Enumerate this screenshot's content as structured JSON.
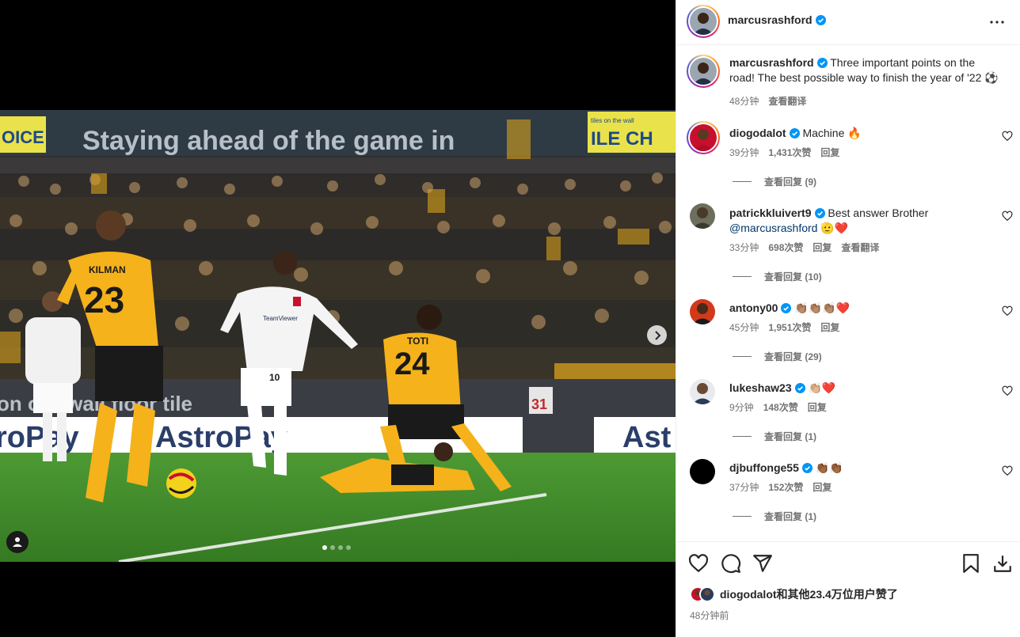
{
  "post": {
    "author": "marcusrashford",
    "caption": "Three important points on the road! The best possible way to finish the year of '22 ⚽",
    "caption_time": "48分钟",
    "translate_label": "查看翻译"
  },
  "photo": {
    "banner_text": "Staying ahead of the game in",
    "board_text_1": "on our wall floor tile",
    "board_text_2": "roPay",
    "board_text_3": "AstroPay",
    "board_text_4": "Ast",
    "board_text_5": "31",
    "sign_left": "OICE",
    "sign_right": "ILE CH",
    "sign_right_top": "tiles on the wall",
    "player_kilman": "KILMAN",
    "player_kilman_number": "23",
    "player_toti": "TOTI",
    "player_toti_number": "24",
    "player_rashford_number": "10",
    "sponsor": "TeamViewer",
    "carousel_count": 4,
    "carousel_active": 0
  },
  "comments": [
    {
      "username": "diogodalot",
      "text": "Machine 🔥",
      "time": "39分钟",
      "likes": "1,431次赞",
      "reply": "回复",
      "view_replies": "查看回复 (9)"
    },
    {
      "username": "patrickkluivert9",
      "text": "Best answer Brother",
      "mention": "@marcusrashford",
      "emoji": "🫡❤️",
      "time": "33分钟",
      "likes": "698次赞",
      "reply": "回复",
      "translate": "查看翻译",
      "view_replies": "查看回复 (10)"
    },
    {
      "username": "antony00",
      "text": "👏🏽👏🏽👏🏽❤️",
      "time": "45分钟",
      "likes": "1,951次赞",
      "reply": "回复",
      "view_replies": "查看回复 (29)"
    },
    {
      "username": "lukeshaw23",
      "text": "👏🏼❤️",
      "time": "9分钟",
      "likes": "148次赞",
      "reply": "回复",
      "view_replies": "查看回复 (1)"
    },
    {
      "username": "djbuffonge55",
      "text": "👏🏾👏🏾",
      "time": "37分钟",
      "likes": "152次赞",
      "reply": "回复",
      "view_replies": "查看回复 (1)"
    }
  ],
  "footer": {
    "likes_text": "diogodalot和其他23.4万位用户赞了",
    "time_ago": "48分钟前"
  },
  "colors": {
    "verified": "#0095f6",
    "heart_red": "#ed4956",
    "wolves_gold": "#f5b21a",
    "pitch_green": "#3f8a2a"
  }
}
